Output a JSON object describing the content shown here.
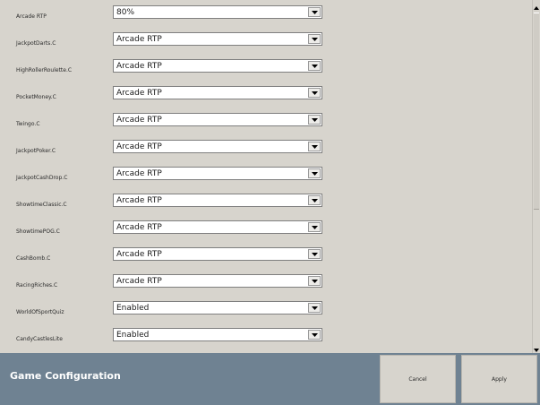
{
  "settings": [
    {
      "label": "Arcade RTP",
      "value": "80%"
    },
    {
      "label": "JackpotDarts.C",
      "value": "Arcade RTP"
    },
    {
      "label": "HighRollerRoulette.C",
      "value": "Arcade RTP"
    },
    {
      "label": "PocketMoney.C",
      "value": "Arcade RTP"
    },
    {
      "label": "Twingo.C",
      "value": "Arcade RTP"
    },
    {
      "label": "JackpotPoker.C",
      "value": "Arcade RTP"
    },
    {
      "label": "JackpotCashDrop.C",
      "value": "Arcade RTP"
    },
    {
      "label": "ShowtimeClassic.C",
      "value": "Arcade RTP"
    },
    {
      "label": "ShowtimePOG.C",
      "value": "Arcade RTP"
    },
    {
      "label": "CashBomb.C",
      "value": "Arcade RTP"
    },
    {
      "label": "RacingRiches.C",
      "value": "Arcade RTP"
    },
    {
      "label": "WorldOfSportQuiz",
      "value": "Enabled"
    },
    {
      "label": "CandyCastlesLite",
      "value": "Enabled"
    }
  ],
  "footer": {
    "title": "Game Configuration",
    "cancel_label": "Cancel",
    "apply_label": "Apply"
  },
  "icons": {
    "dropdown": "chevron-down-icon",
    "scroll_up": "scroll-up-arrow-icon",
    "scroll_down": "scroll-down-arrow-icon"
  },
  "colors": {
    "background": "#d7d4cd",
    "footer": "#6f8292",
    "footer_text": "#ffffff"
  }
}
